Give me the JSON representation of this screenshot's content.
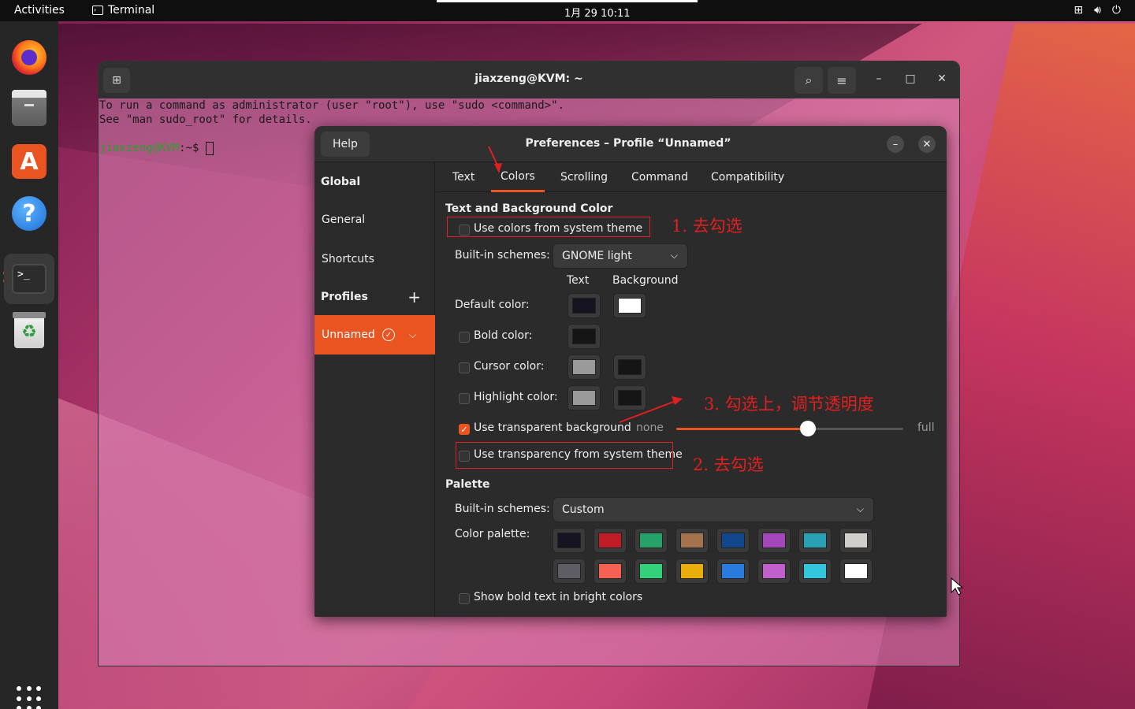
{
  "topbar": {
    "activities": "Activities",
    "app_name": "Terminal",
    "clock": "1月 29  10:11",
    "tray": [
      "network-icon",
      "volume-icon",
      "power-icon"
    ]
  },
  "dock": {
    "items": [
      "firefox-icon",
      "files-icon",
      "app-store-icon",
      "help-icon",
      "terminal-icon",
      "trash-icon"
    ],
    "term_glyph": ">_"
  },
  "terminal": {
    "title": "jiaxzeng@KVM: ~",
    "lines": [
      "To run a command as administrator (user \"root\"), use \"sudo <command>\".",
      "See \"man sudo_root\" for details."
    ],
    "prompt_user": "jiaxzeng@KVM",
    "prompt_path": ":~$ "
  },
  "prefs": {
    "help": "Help",
    "title": "Preferences – Profile “Unnamed”",
    "sidebar": {
      "global": "Global",
      "general": "General",
      "shortcuts": "Shortcuts",
      "profiles": "Profiles",
      "profile_name": "Unnamed"
    },
    "tabs": [
      "Text",
      "Colors",
      "Scrolling",
      "Command",
      "Compatibility"
    ],
    "colors": {
      "section1": "Text and Background Color",
      "use_system_theme": "Use colors from system theme",
      "builtin_label": "Built-in schemes:",
      "builtin_value": "GNOME light",
      "col_text": "Text",
      "col_background": "Background",
      "default_color": "Default color:",
      "bold_color": "Bold color:",
      "cursor_color": "Cursor color:",
      "highlight_color": "Highlight color:",
      "use_transparent": "Use transparent background",
      "none": "none",
      "full": "full",
      "transparency_level": 0.58,
      "use_transparency_system": "Use transparency from system theme",
      "palette_header": "Palette",
      "palette_builtin_label": "Built-in schemes:",
      "palette_builtin_value": "Custom",
      "palette_label": "Color palette:",
      "show_bold_bright": "Show bold text in bright colors",
      "default_text_color": "#171421",
      "default_bg_color": "#ffffff",
      "bold_text_color": "#151515",
      "cursor_text_color": "#9a9a9a",
      "cursor_bg_color": "#151515",
      "highlight_text_color": "#9a9a9a",
      "highlight_bg_color": "#151515",
      "palette_row1": [
        "#171421",
        "#c01c28",
        "#26a269",
        "#a2734c",
        "#12488b",
        "#a347ba",
        "#2aa1b3",
        "#d0cfcc"
      ],
      "palette_row2": [
        "#5e5c64",
        "#f66151",
        "#33d17a",
        "#e9ad0c",
        "#2a7bde",
        "#c061cb",
        "#33c7de",
        "#ffffff"
      ]
    }
  },
  "annotations": {
    "a1": "1. 去勾选",
    "a2": "2. 去勾选",
    "a3": "3. 勾选上，调节透明度"
  },
  "accent_color": "#e95420"
}
